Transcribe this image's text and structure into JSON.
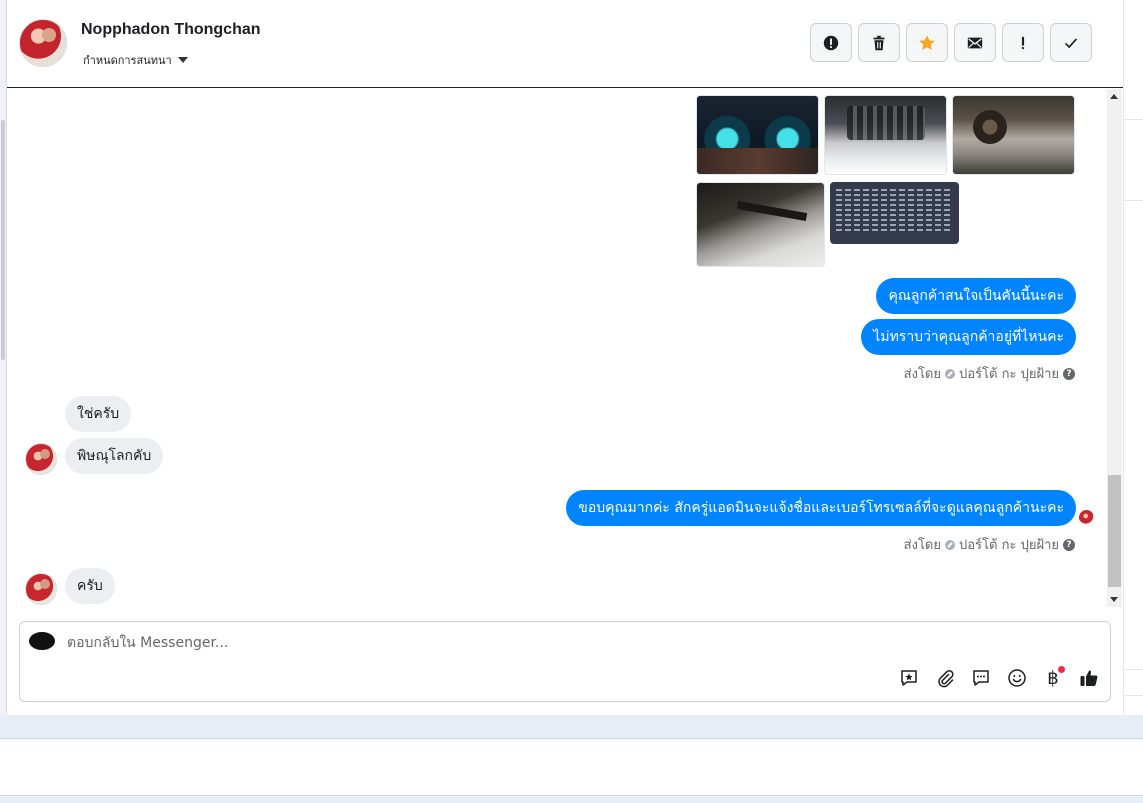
{
  "header": {
    "contact_name": "Nopphadon Thongchan",
    "assign_label": "กำหนดการสนทนา"
  },
  "toolbar": [
    {
      "name": "report-spam-button",
      "icon": "exclamation-circle-icon"
    },
    {
      "name": "delete-button",
      "icon": "trash-icon"
    },
    {
      "name": "star-button",
      "icon": "star-icon",
      "color": "#f5a623"
    },
    {
      "name": "mark-unread-button",
      "icon": "envelope-icon"
    },
    {
      "name": "mark-important-button",
      "icon": "exclamation-icon"
    },
    {
      "name": "mark-done-button",
      "icon": "checkmark-icon"
    }
  ],
  "messages": {
    "out_1": "คุณลูกค้าสนใจเป็นคันนี้นะคะ",
    "out_2": "ไม่ทราบว่าคุณลูกค้าอยู่ที่ไหนคะ",
    "sent_by_1": {
      "prefix": "ส่งโดย",
      "agent": "ปอร์โต้ กะ ปุยฝ้าย"
    },
    "in_1": "ใช่ครับ",
    "in_2": "พิษณุโลกคับ",
    "out_3": "ขอบคุณมากค่ะ  สักครู่แอดมินจะแจ้งชื่อและเบอร์โทรเซลล์ที่จะดูแลคุณลูกค้านะคะ",
    "sent_by_2": {
      "prefix": "ส่งโดย",
      "agent": "ปอร์โต้ กะ ปุยฝ้าย"
    },
    "in_3": "ครับ"
  },
  "composer": {
    "placeholder": "ตอบกลับใน Messenger...",
    "value": "",
    "currency_symbol": "฿"
  },
  "colors": {
    "outgoing_bubble": "#0084ff",
    "incoming_bubble": "#eceef2",
    "notification_dot": "#f02849"
  }
}
